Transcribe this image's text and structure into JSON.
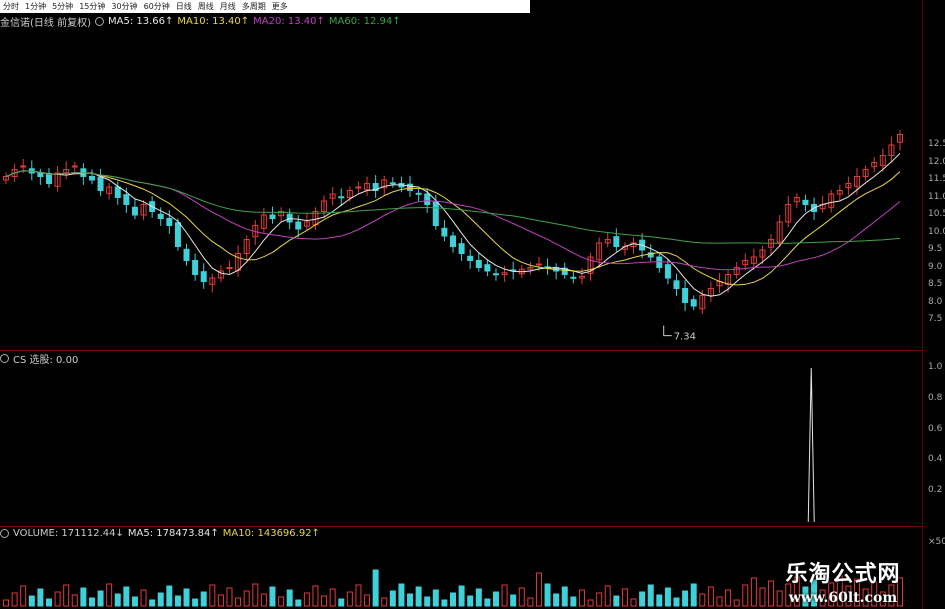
{
  "toolbar": {
    "items": [
      "分时",
      "1分钟",
      "5分钟",
      "15分钟",
      "30分钟",
      "60分钟",
      "日线",
      "周线",
      "月线",
      "多周期",
      "更多"
    ]
  },
  "main_header": {
    "title": "金信诺(日线 前复权)",
    "ma5": "MA5: 13.66↑",
    "ma10": "MA10: 13.40↑",
    "ma20": "MA20: 13.40↑",
    "ma60": "MA60: 12.94↑"
  },
  "price_axis": {
    "ticks": [
      "12.5",
      "12.0",
      "11.5",
      "11.0",
      "10.5",
      "10.0",
      "9.5",
      "9.0",
      "8.5",
      "8.0",
      "7.5"
    ]
  },
  "low_label": "7.34",
  "cs_header": {
    "label": "CS 选股: 0.00"
  },
  "cs_axis": {
    "ticks": [
      "1.0",
      "0.8",
      "0.6",
      "0.4",
      "0.2"
    ]
  },
  "vol_header": {
    "volume": "VOLUME: 171112.44↓",
    "ma5": "MA5: 178473.84↑",
    "ma10": "MA10: 143696.92↑"
  },
  "vol_axis": {
    "ticks": [
      "×50"
    ]
  },
  "watermark": {
    "title": "乐淘公式网",
    "url": "www.60lt.com"
  },
  "colors": {
    "up": "#e23a3a",
    "down": "#3fd0d8",
    "ma5": "#e6e6e6",
    "ma10": "#e8d64a",
    "ma20": "#c040c0",
    "ma60": "#3fa24a",
    "cs_line": "#e6e6e6"
  },
  "chart_data": {
    "type": "candlestick",
    "series": [
      {
        "name": "MA5",
        "last": 13.66
      },
      {
        "name": "MA10",
        "last": 13.4
      },
      {
        "name": "MA20",
        "last": 13.4
      },
      {
        "name": "MA60",
        "last": 12.94
      }
    ],
    "close": [
      11.6,
      11.8,
      11.9,
      11.7,
      11.6,
      11.4,
      11.7,
      11.8,
      11.9,
      11.6,
      11.5,
      11.2,
      11.3,
      11.0,
      10.8,
      10.5,
      10.8,
      10.6,
      10.4,
      10.2,
      9.6,
      9.2,
      8.8,
      8.6,
      8.7,
      8.9,
      9.0,
      9.4,
      9.8,
      10.2,
      10.5,
      10.4,
      10.6,
      10.3,
      10.1,
      10.3,
      10.6,
      10.9,
      11.1,
      11.0,
      11.2,
      11.3,
      11.4,
      11.2,
      11.5,
      11.4,
      11.3,
      11.2,
      11.1,
      10.8,
      10.2,
      9.9,
      9.6,
      9.4,
      9.2,
      9.0,
      8.9,
      8.8,
      8.85,
      8.9,
      8.95,
      9.0,
      9.1,
      9.0,
      8.9,
      8.8,
      8.7,
      8.75,
      9.3,
      9.7,
      9.8,
      9.6,
      9.6,
      9.7,
      9.5,
      9.3,
      9.0,
      8.7,
      8.4,
      8.0,
      7.9,
      8.2,
      8.4,
      8.6,
      8.8,
      9.0,
      9.2,
      9.3,
      9.5,
      9.8,
      10.3,
      10.8,
      11.0,
      10.8,
      10.6,
      10.8,
      11.1,
      11.2,
      11.4,
      11.6,
      11.8,
      12.0,
      12.2,
      12.5,
      12.8
    ],
    "low_marker": 7.34,
    "cs_signal": {
      "index": 96,
      "value": 1.0,
      "baseline": 0.0
    },
    "volume_ma": {
      "ma5": 178473.84,
      "ma10": 143696.92,
      "last": 171112.44
    }
  }
}
